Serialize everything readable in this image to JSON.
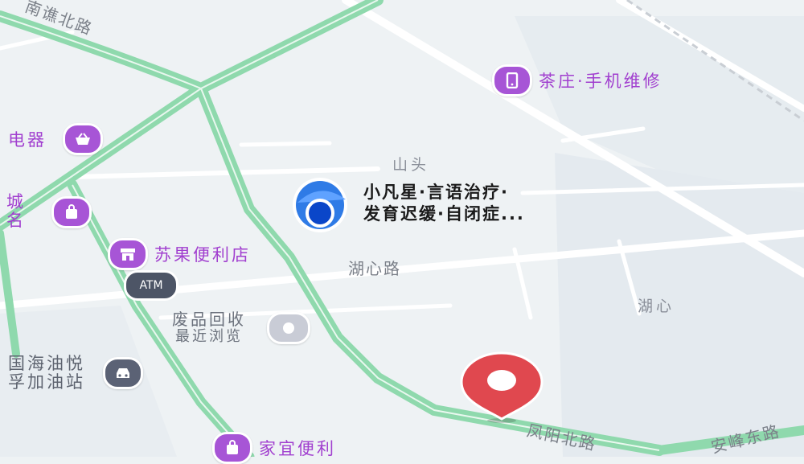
{
  "map": {
    "pois": {
      "phone_repair": {
        "label": "茶庄·手机维修",
        "icon": "phone-icon"
      },
      "appliance": {
        "label": "电器",
        "icon": "basket-icon"
      },
      "mall": {
        "label_line1": "城",
        "label_line2": "名",
        "icon": "shopping-bag-icon"
      },
      "convenience_store": {
        "label": "苏果便利店",
        "icon": "store-icon"
      },
      "atm": {
        "label": "ATM"
      },
      "speech_therapy": {
        "line1": "小凡星·言语治疗·",
        "line2": "发育迟缓·自闭症..."
      },
      "recycling": {
        "line1": "废品回收",
        "line2": "最近浏览"
      },
      "gas_station": {
        "line1": "国海油悦",
        "line2": "孚加油站",
        "icon": "car-icon"
      },
      "family_store": {
        "label": "家宜便利",
        "icon": "shopping-bag-icon"
      }
    },
    "area_labels": {
      "shantou": "山头",
      "huxin": "湖心"
    },
    "roads": {
      "nanqiao": "南谯北路",
      "huxin_road": "湖心路",
      "fengyang": "凤阳北路",
      "anfeng": "安峰东路"
    },
    "colors": {
      "background": "#eef2f4",
      "road_green": "#86d6a8",
      "poi_purple": "#a755d6",
      "destination_red": "#e0484f",
      "location_blue": "#2f7be6"
    }
  }
}
